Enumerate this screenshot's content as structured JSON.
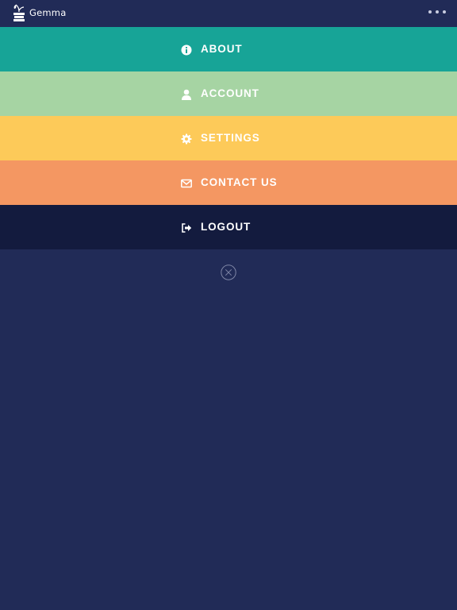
{
  "app": {
    "name": "Gemma",
    "logo_icon": "plant-books-icon"
  },
  "header": {
    "more_icon": "more-horizontal-icon"
  },
  "menu": {
    "items": [
      {
        "label": "ABOUT",
        "icon": "info-icon",
        "color": "#17a497"
      },
      {
        "label": "ACCOUNT",
        "icon": "user-icon",
        "color": "#a6d4a3"
      },
      {
        "label": "SETTINGS",
        "icon": "gear-icon",
        "color": "#fdca59"
      },
      {
        "label": "CONTACT US",
        "icon": "envelope-icon",
        "color": "#f49762"
      },
      {
        "label": "LOGOUT",
        "icon": "sign-out-icon",
        "color": "#131b3e"
      }
    ]
  },
  "close": {
    "icon": "close-icon"
  },
  "colors": {
    "background": "#212b57",
    "text": "#ffffff"
  }
}
